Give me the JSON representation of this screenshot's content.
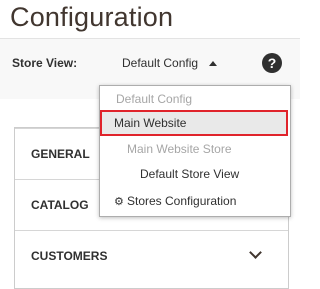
{
  "page": {
    "title": "Configuration"
  },
  "store_switcher": {
    "label": "Store View:",
    "value": "Default Config",
    "help_glyph": "?"
  },
  "dropdown": {
    "items": [
      {
        "label": "Default Config",
        "state": "disabled"
      },
      {
        "label": "Main Website",
        "state": "selected"
      },
      {
        "label": "Main Website Store",
        "state": "disabled"
      },
      {
        "label": "Default Store View",
        "state": "active"
      },
      {
        "label": "Stores Configuration",
        "state": "active",
        "icon": "gear-icon"
      }
    ]
  },
  "sections": [
    {
      "label": "GENERAL"
    },
    {
      "label": "CATALOG"
    },
    {
      "label": "CUSTOMERS"
    }
  ],
  "colors": {
    "accent_border": "#e0232b",
    "text": "#303030"
  }
}
